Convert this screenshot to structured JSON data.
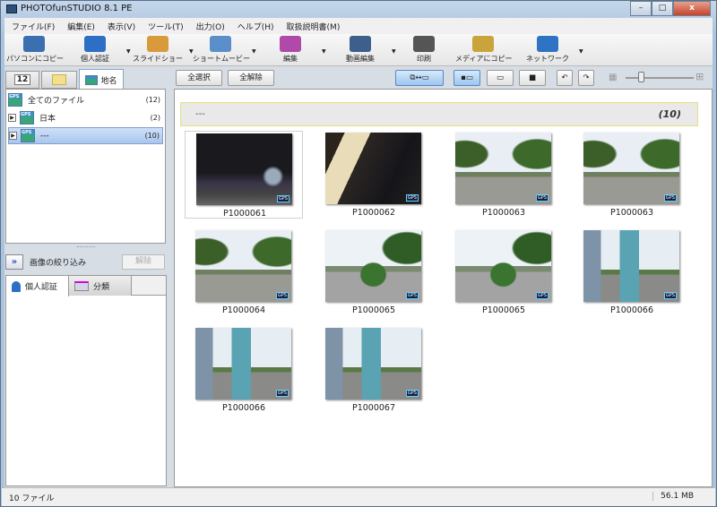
{
  "window": {
    "title": "PHOTOfunSTUDIO 8.1 PE",
    "minimize": "–",
    "maximize": "□",
    "close": "x"
  },
  "menu": [
    "ファイル(F)",
    "編集(E)",
    "表示(V)",
    "ツール(T)",
    "出力(O)",
    "ヘルプ(H)",
    "取扱説明書(M)"
  ],
  "toolbar": [
    {
      "label": "パソコンにコピー",
      "icon": "copy-to-pc-icon",
      "color": "#3a6fb0",
      "dropdown": false
    },
    {
      "label": "個人認証",
      "icon": "person-icon",
      "color": "#2d6fc4",
      "dropdown": true
    },
    {
      "label": "スライドショー",
      "icon": "slideshow-icon",
      "color": "#d89a3a",
      "dropdown": true
    },
    {
      "label": "ショートムービー",
      "icon": "movie-icon",
      "color": "#5a8fc9",
      "dropdown": true
    },
    {
      "label": "編集",
      "icon": "edit-icon",
      "color": "#b04aa8",
      "dropdown": true
    },
    {
      "label": "動画編集",
      "icon": "video-edit-icon",
      "color": "#3c5f8c",
      "dropdown": true
    },
    {
      "label": "印刷",
      "icon": "printer-icon",
      "color": "#555555",
      "dropdown": false
    },
    {
      "label": "メディアにコピー",
      "icon": "disc-icon",
      "color": "#c9a43a",
      "dropdown": false
    },
    {
      "label": "ネットワーク",
      "icon": "network-icon",
      "color": "#2f74c4",
      "dropdown": true
    }
  ],
  "left": {
    "tabs": [
      {
        "label": "12",
        "icon": "calendar-icon"
      },
      {
        "label": "",
        "icon": "folder-icon"
      },
      {
        "label": "地名",
        "icon": "map-icon"
      }
    ],
    "tree": [
      {
        "label": "全てのファイル",
        "count": "(12)"
      },
      {
        "label": "日本",
        "count": "(2)"
      },
      {
        "label": "---",
        "count": "(10)"
      }
    ],
    "gps": "GPS",
    "filter_label": "画像の絞り込み",
    "clear_label": "解除",
    "bottom_tabs": [
      "個人認証",
      "分類"
    ]
  },
  "right": {
    "select_all": "全選択",
    "deselect_all": "全解除",
    "group": {
      "name": "---",
      "count": "(10)"
    },
    "thumbs": [
      {
        "name": "P1000061",
        "scene": "s1"
      },
      {
        "name": "P1000062",
        "scene": "s2"
      },
      {
        "name": "P1000063",
        "scene": "s3"
      },
      {
        "name": "P1000063",
        "scene": "s3"
      },
      {
        "name": "P1000064",
        "scene": "s3"
      },
      {
        "name": "P1000065",
        "scene": "s5"
      },
      {
        "name": "P1000065",
        "scene": "s5"
      },
      {
        "name": "P1000066",
        "scene": "s6"
      },
      {
        "name": "P1000066",
        "scene": "s6"
      },
      {
        "name": "P1000067",
        "scene": "s6"
      }
    ],
    "badge": "GPS",
    "thumb_size_slider": 0.2
  },
  "status": {
    "files": "10 ファイル",
    "size": "56.1 MB"
  }
}
